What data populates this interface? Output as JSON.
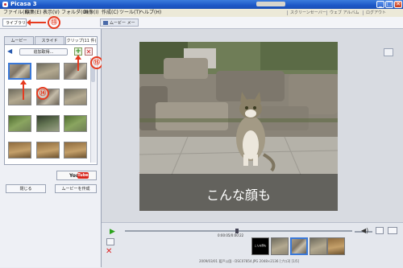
{
  "window": {
    "title": "Picasa 3",
    "minimize": "_",
    "maximize": "□",
    "close": "✕"
  },
  "menu": {
    "items": [
      "ファイル(F)",
      "編集(E)",
      "表示(V)",
      "フォルダ(O)",
      "画像(I)",
      "作成(C)",
      "ツール(T)",
      "ヘルプ(H)"
    ],
    "links": [
      "スクリーンセーバー",
      "ウェブ アルバム",
      "ログアウト"
    ]
  },
  "tabs": {
    "library": "ライブラリ",
    "movie_maker": "ムービー メーカー"
  },
  "left_panel": {
    "tabs": [
      "ムービー",
      "スライド",
      "クリップ(11 件)"
    ],
    "add_files": "追加取得...",
    "plus": "+",
    "remove": "✕",
    "back": "◀"
  },
  "annotations": {
    "a13": "⑬",
    "a14": "⑭",
    "a15": "⑮"
  },
  "youtube": {
    "you": "You",
    "tube": "Tube"
  },
  "buttons": {
    "close": "閉じる",
    "make_movie": "ムービーを作成"
  },
  "preview": {
    "caption": "こんな顔も"
  },
  "timeline": {
    "play": "▶",
    "time": "0:00:05/0:00:22",
    "volume": "◀)",
    "remove": "✕",
    "title_slide_text": "こんな顔も"
  },
  "status": {
    "text": "2009/03/01 葛戸公園 - DSC07854.JPG    2048×2136 [プロ3]    [1/5]"
  },
  "colors": {
    "titlebar": "#1d58c7",
    "accent": "#3a78d8",
    "annotation": "#e63a1f",
    "youtube": "#d8261c"
  }
}
